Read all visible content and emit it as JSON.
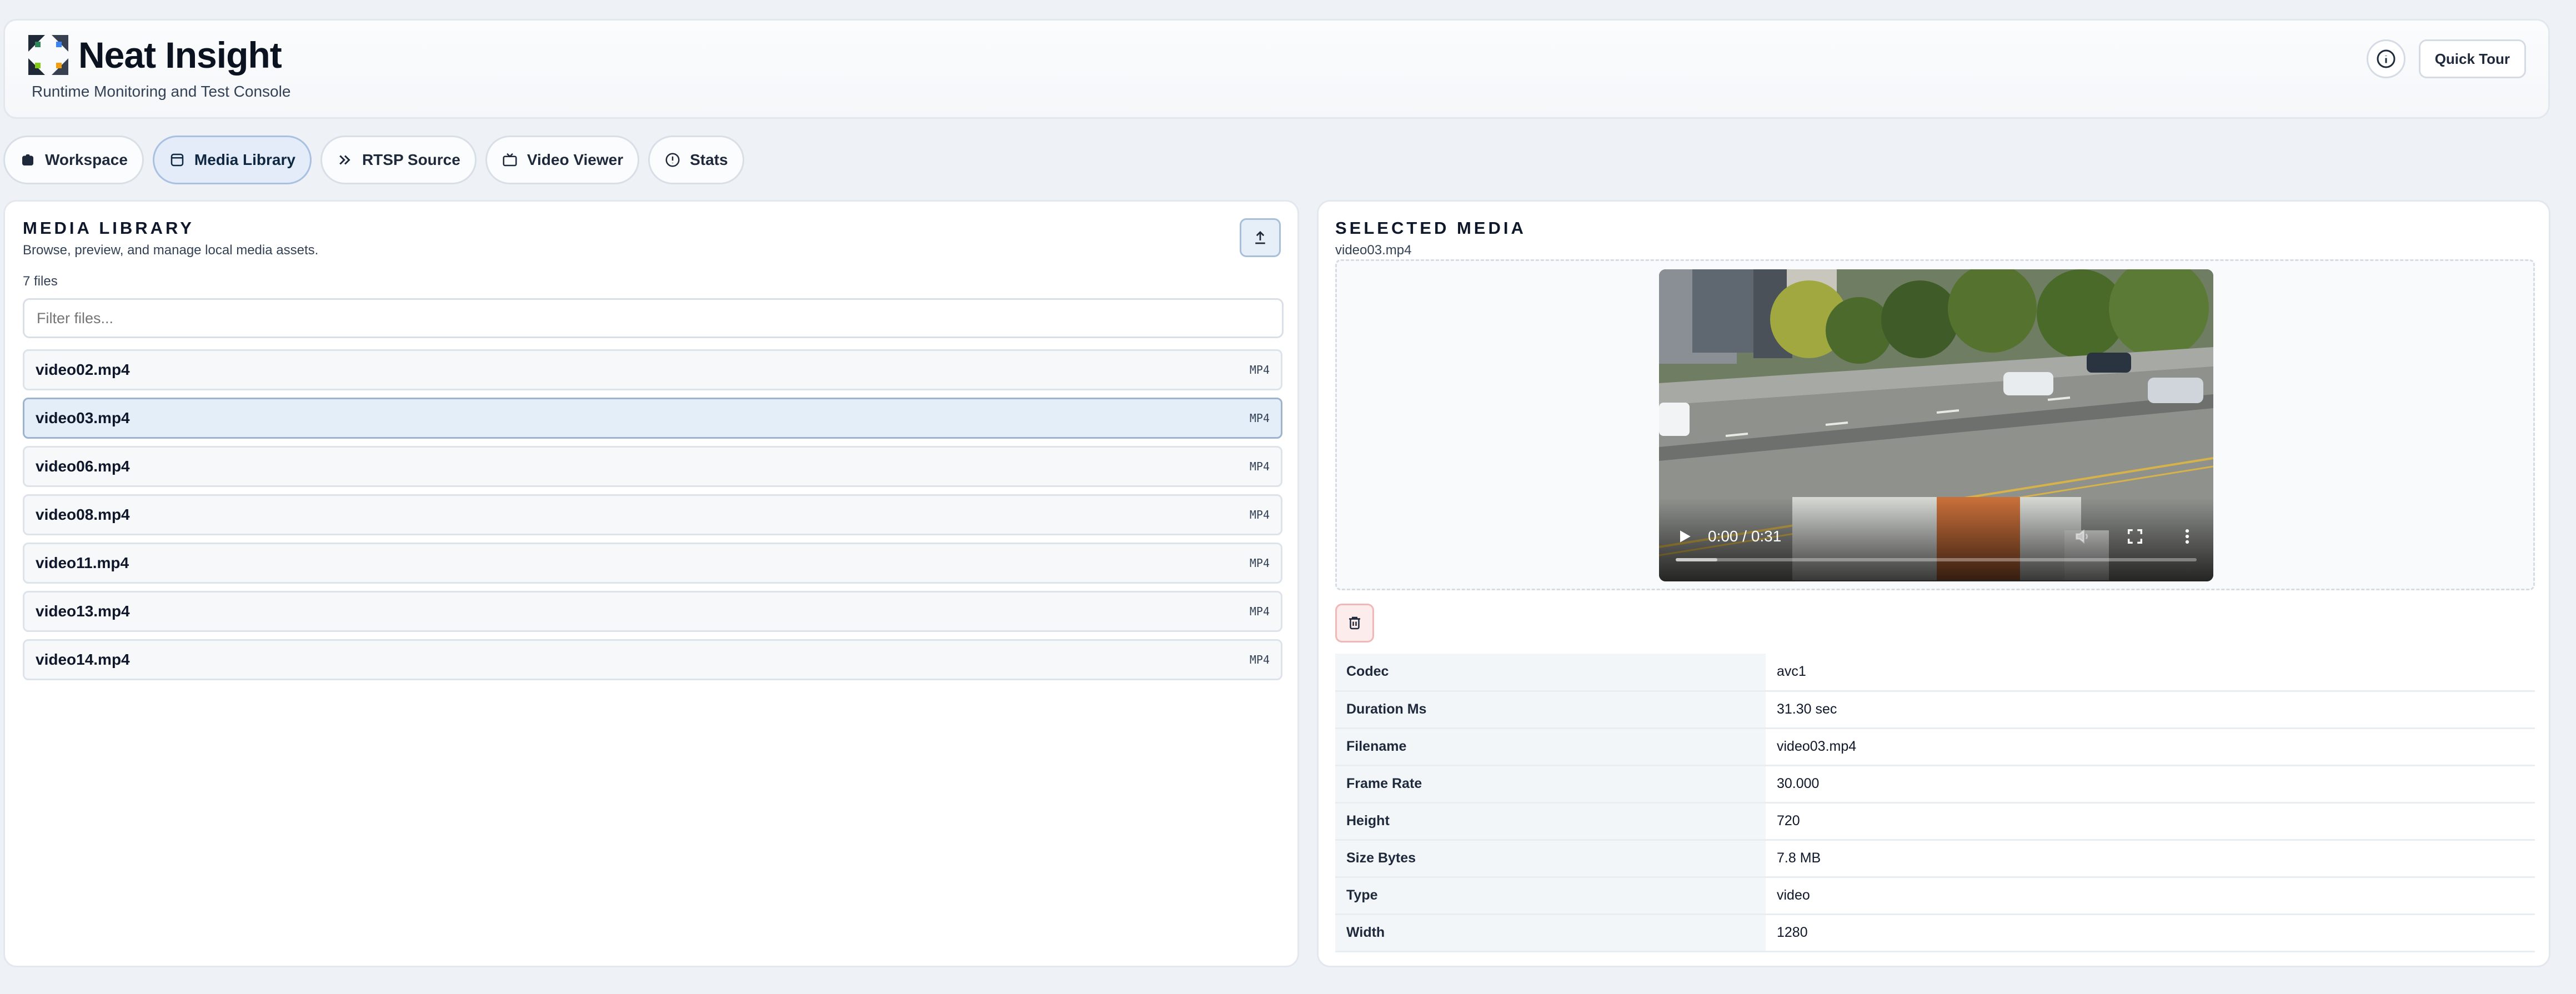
{
  "header": {
    "title": "Neat Insight",
    "subtitle": "Runtime Monitoring and Test Console",
    "info_icon": "info-icon",
    "quick_tour": "Quick Tour"
  },
  "tabs": [
    {
      "label": "Workspace",
      "icon": "workspace-icon",
      "active": false
    },
    {
      "label": "Media Library",
      "icon": "media-icon",
      "active": true
    },
    {
      "label": "RTSP Source",
      "icon": "rtsp-icon",
      "active": false
    },
    {
      "label": "Video Viewer",
      "icon": "tv-icon",
      "active": false
    },
    {
      "label": "Stats",
      "icon": "stats-icon",
      "active": false
    }
  ],
  "library": {
    "title": "MEDIA LIBRARY",
    "subtitle": "Browse, preview, and manage local media assets.",
    "count": "7 files",
    "filter_placeholder": "Filter files...",
    "upload_icon": "upload-icon",
    "files": [
      {
        "name": "video02.mp4",
        "type": "MP4",
        "selected": false
      },
      {
        "name": "video03.mp4",
        "type": "MP4",
        "selected": true
      },
      {
        "name": "video06.mp4",
        "type": "MP4",
        "selected": false
      },
      {
        "name": "video08.mp4",
        "type": "MP4",
        "selected": false
      },
      {
        "name": "video11.mp4",
        "type": "MP4",
        "selected": false
      },
      {
        "name": "video13.mp4",
        "type": "MP4",
        "selected": false
      },
      {
        "name": "video14.mp4",
        "type": "MP4",
        "selected": false
      }
    ]
  },
  "selected": {
    "title": "SELECTED MEDIA",
    "filename": "video03.mp4",
    "player": {
      "time": "0:00 / 0:31",
      "progress": 0
    },
    "delete_icon": "trash-icon",
    "metadata": [
      {
        "key": "Codec",
        "value": "avc1"
      },
      {
        "key": "Duration Ms",
        "value": "31.30 sec"
      },
      {
        "key": "Filename",
        "value": "video03.mp4"
      },
      {
        "key": "Frame Rate",
        "value": "30.000"
      },
      {
        "key": "Height",
        "value": "720"
      },
      {
        "key": "Size Bytes",
        "value": "7.8 MB"
      },
      {
        "key": "Type",
        "value": "video"
      },
      {
        "key": "Width",
        "value": "1280"
      }
    ]
  },
  "colors": {
    "accent": "#a9c1e0",
    "active_tab_bg": "#e3ecf8",
    "danger_bg": "#fdecec"
  }
}
